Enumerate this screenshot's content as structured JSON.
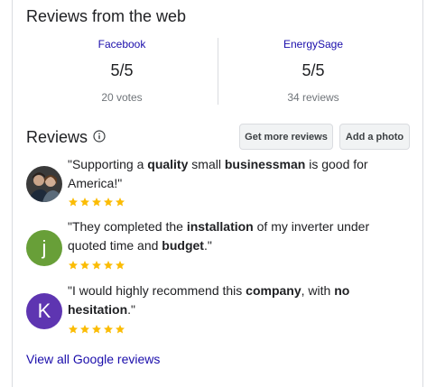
{
  "web_reviews": {
    "title": "Reviews from the web",
    "sources": [
      {
        "name": "Facebook",
        "score": "5/5",
        "count": "20 votes"
      },
      {
        "name": "EnergySage",
        "score": "5/5",
        "count": "34 reviews"
      }
    ]
  },
  "reviews": {
    "title": "Reviews",
    "info_icon": "info-icon",
    "buttons": {
      "more": "Get more reviews",
      "photo": "Add a photo"
    },
    "items": [
      {
        "avatar_type": "photo",
        "rating": 5,
        "quote": [
          {
            "t": "\"Supporting a ",
            "b": false
          },
          {
            "t": "quality",
            "b": true
          },
          {
            "t": " small ",
            "b": false
          },
          {
            "t": "businessman",
            "b": true
          },
          {
            "t": " is good for America!\"",
            "b": false
          }
        ]
      },
      {
        "avatar_type": "letter",
        "avatar_letter": "j",
        "avatar_color": "#689f38",
        "rating": 5,
        "quote": [
          {
            "t": "\"They completed the ",
            "b": false
          },
          {
            "t": "installation",
            "b": true
          },
          {
            "t": " of my inverter under quoted time and ",
            "b": false
          },
          {
            "t": "budget",
            "b": true
          },
          {
            "t": ".\"",
            "b": false
          }
        ]
      },
      {
        "avatar_type": "letter",
        "avatar_letter": "K",
        "avatar_color": "#5e35b1",
        "rating": 5,
        "quote": [
          {
            "t": "\"I would highly recommend this ",
            "b": false
          },
          {
            "t": "company",
            "b": true
          },
          {
            "t": ", with ",
            "b": false
          },
          {
            "t": "no hesitation",
            "b": true
          },
          {
            "t": ".\"",
            "b": false
          }
        ]
      }
    ],
    "view_all": "View all Google reviews"
  },
  "colors": {
    "star": "#fbbc04",
    "link": "#1a0dab"
  }
}
